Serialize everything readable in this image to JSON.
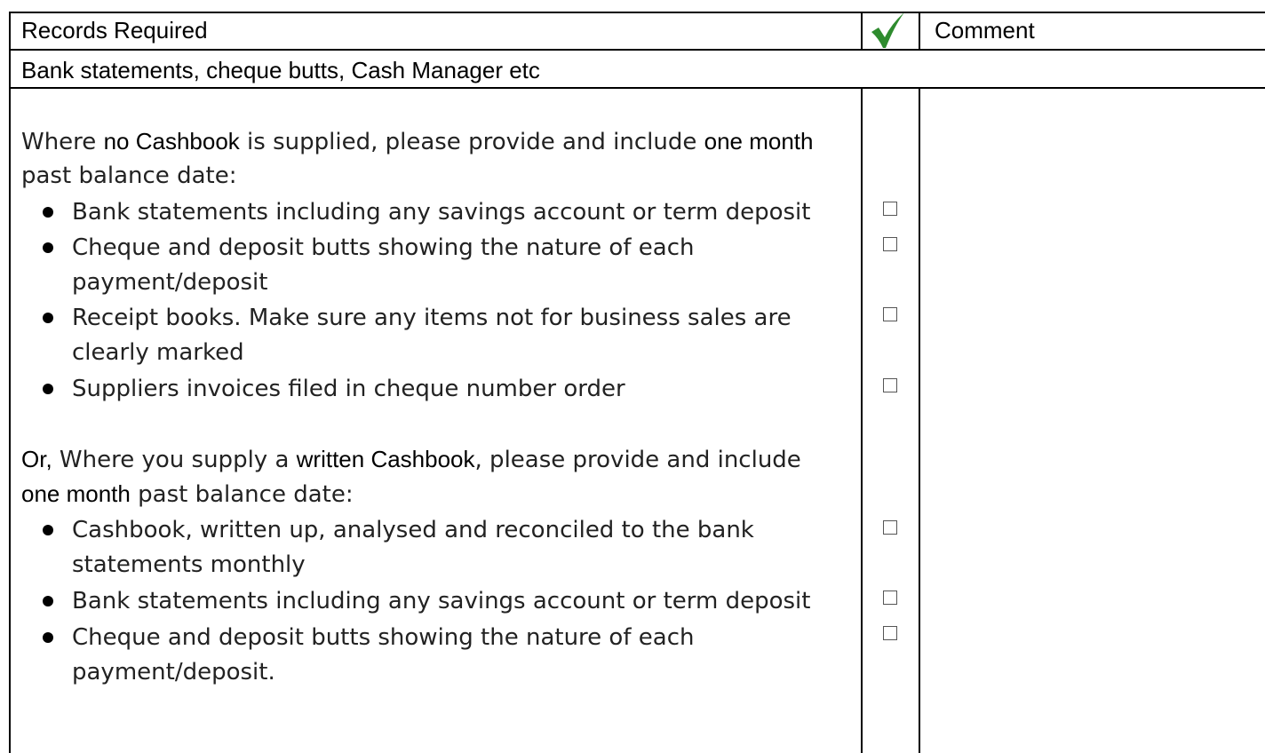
{
  "header": {
    "records_label": "Records Required",
    "check_icon": "green-checkmark-icon",
    "check_color": "#2e8b2e",
    "comment_label": "Comment"
  },
  "section": {
    "title": "Bank statements, cheque butts, Cash Manager etc"
  },
  "part1": {
    "intro_a": "Where ",
    "intro_b": "no Cashbook",
    "intro_c": " is supplied, please provide and include ",
    "intro_d": "one month",
    "intro_line2": "past balance date:",
    "items": [
      {
        "text": "Bank statements including any savings account or term deposit",
        "cont": ""
      },
      {
        "text": "Cheque and deposit butts showing the nature of each",
        "cont": "payment/deposit"
      },
      {
        "text": "Receipt books.  Make sure any items not for business sales are",
        "cont": "clearly marked"
      },
      {
        "text": "Suppliers invoices filed in cheque number order",
        "cont": ""
      }
    ]
  },
  "part2": {
    "intro_a": "Or,",
    "intro_b": " Where you supply a ",
    "intro_c": "written Cashbook",
    "intro_d": ", please provide and include",
    "intro_e": "one month",
    "intro_f": " past balance date:",
    "items": [
      {
        "text": "Cashbook, written up, analysed and reconciled to the bank",
        "cont": "statements monthly"
      },
      {
        "text": "Bank statements including any savings account or term deposit",
        "cont": ""
      },
      {
        "text": "Cheque and deposit butts showing the nature of each",
        "cont": "payment/deposit."
      }
    ]
  }
}
